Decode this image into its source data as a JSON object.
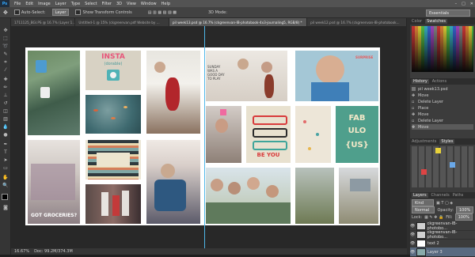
{
  "app": {
    "logo": "Ps"
  },
  "menu": [
    "File",
    "Edit",
    "Image",
    "Layer",
    "Type",
    "Select",
    "Filter",
    "3D",
    "View",
    "Window",
    "Help"
  ],
  "window_controls": [
    "–",
    "□",
    "✕"
  ],
  "options": {
    "auto_select_label": "Auto-Select:",
    "auto_select_target": "Layer",
    "transform_label": "Show Transform Controls",
    "mode_3d": "3D Mode:",
    "workspace": "Essentials"
  },
  "tabs": [
    {
      "label": "1711125_BGI.PS @ 16.7% (Layer 1...",
      "active": false
    },
    {
      "label": "Untitled-1 @ 15% (ckgreenvan.pdf Website by ...",
      "active": false
    },
    {
      "label": "pil week13.psd @ 16.7% (ckgreenvan-IB-photobook-4x3-journaling5, RGB/8) *",
      "active": true
    },
    {
      "label": "pil week12.psd @ 16.7% (ckgreenvan-IB-photobook...",
      "active": false
    }
  ],
  "collage": {
    "insta_title": "INSTA",
    "insta_sub": "(dorable)",
    "beyou": "BE YOU",
    "fab_line1": "FAB",
    "fab_line2": "ULO",
    "fab_line3": "{US}",
    "groceries": "GOT GROCERIES?",
    "journal_text": "SUNDAY WAS A GOOD DAY TO PLAY"
  },
  "status": {
    "zoom": "16.67%",
    "doc": "Doc: 99.2M/374.3M"
  },
  "panels": {
    "color_tabs": [
      "Color",
      "Swatches"
    ],
    "history_tabs": [
      "History",
      "Actions"
    ],
    "history_doc": "pil week13.psd",
    "history_items": [
      "Move",
      "Delete Layer",
      "Place",
      "Move",
      "Delete Layer",
      "Move"
    ],
    "adjust_tabs": [
      "Adjustments",
      "Styles"
    ],
    "layers_tabs": [
      "Layers",
      "Channels",
      "Paths"
    ],
    "layers_kind": "Kind",
    "blend_mode": "Normal",
    "opacity_label": "Opacity:",
    "opacity_value": "100%",
    "lock_label": "Lock:",
    "fill_label": "Fill:",
    "fill_value": "100%",
    "layers": [
      {
        "name": "ckgreenvan-IB-photobo..."
      },
      {
        "name": "ckgreenvan-IB-photobo..."
      },
      {
        "name": "text 2"
      },
      {
        "name": "Layer 3"
      },
      {
        "name": "ckgreenvan-IB-photob..."
      }
    ]
  },
  "colors": {
    "accent": "#31a8ff",
    "guide": "#4fb7e8",
    "fg": "#000000",
    "bg": "#ffffff"
  }
}
